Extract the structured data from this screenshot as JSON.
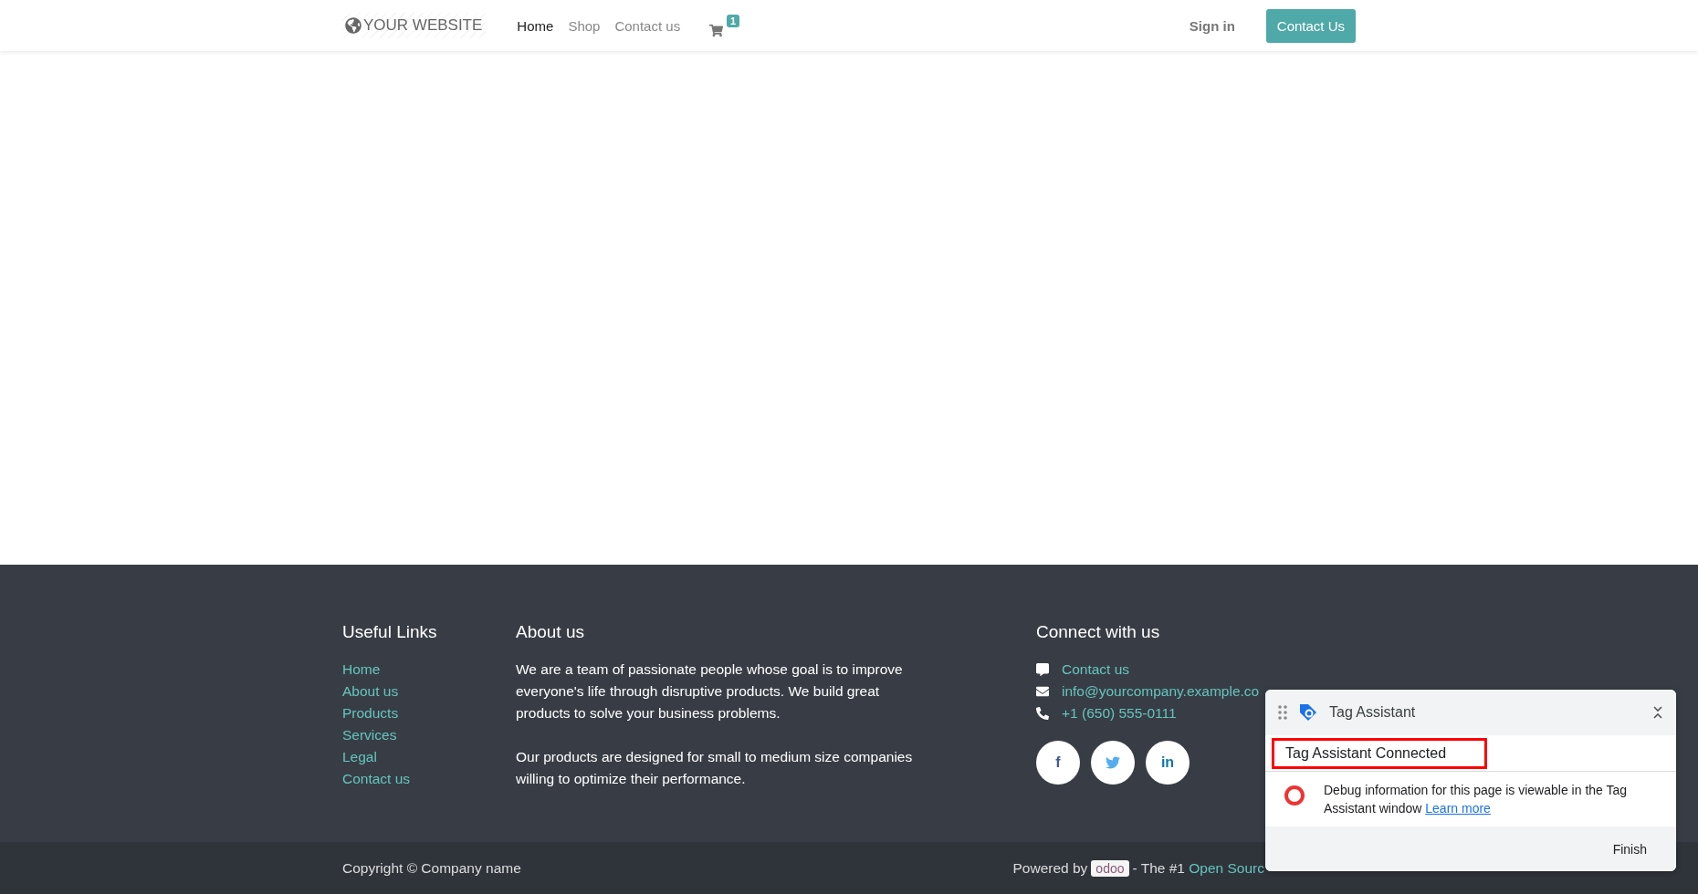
{
  "header": {
    "logo": "YOUR WEBSITE",
    "nav": [
      {
        "label": "Home",
        "selected": true
      },
      {
        "label": "Shop",
        "selected": false
      },
      {
        "label": "Contact us",
        "selected": false
      }
    ],
    "cart_count": "1",
    "sign_in": "Sign in",
    "cta": "Contact Us"
  },
  "footer": {
    "useful_links": {
      "title": "Useful Links",
      "links": [
        "Home",
        "About us",
        "Products",
        "Services",
        "Legal",
        "Contact us"
      ]
    },
    "about": {
      "title": "About us",
      "paragraphs": [
        "We are a team of passionate people whose goal is to improve everyone's life through disruptive products. We build great products to solve your business problems.",
        "Our products are designed for small to medium size companies willing to optimize their performance."
      ]
    },
    "connect": {
      "title": "Connect with us",
      "contacts": [
        {
          "kind": "chat",
          "text": "Contact us"
        },
        {
          "kind": "mail",
          "text": "info@yourcompany.example.co"
        },
        {
          "kind": "phone",
          "text": "+1 (650) 555-0111"
        }
      ],
      "social": [
        {
          "kind": "facebook",
          "label": "f"
        },
        {
          "kind": "twitter"
        },
        {
          "kind": "linkedin",
          "label": "in"
        }
      ]
    }
  },
  "bottom_bar": {
    "copyright": "Copyright © Company name",
    "powered_by": "Powered by",
    "brand": "odoo",
    "tagline": "- The #1",
    "link": "Open Sourc"
  },
  "tag_assistant": {
    "title": "Tag Assistant",
    "status": "Tag Assistant Connected",
    "message": "Debug information for this page is viewable in the Tag Assistant window",
    "learn_more": "Learn more",
    "finish": "Finish"
  }
}
